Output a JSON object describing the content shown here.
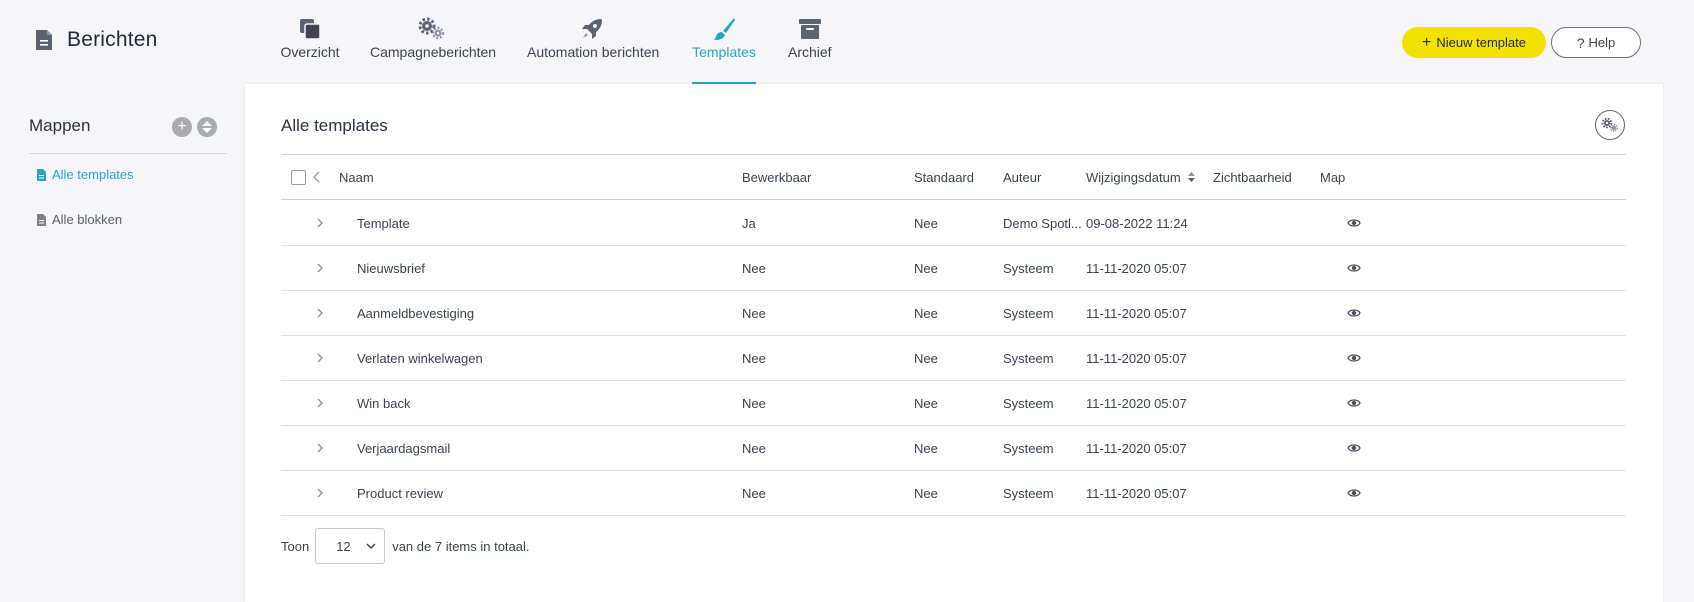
{
  "header": {
    "app_title": "Berichten",
    "nav": [
      {
        "label": "Overzicht",
        "icon": "overview-icon"
      },
      {
        "label": "Campagneberichten",
        "icon": "gears-icon"
      },
      {
        "label": "Automation berichten",
        "icon": "rocket-icon"
      },
      {
        "label": "Templates",
        "icon": "paintbrush-icon",
        "active": true
      },
      {
        "label": "Archief",
        "icon": "archive-box-icon"
      }
    ],
    "new_template_label": "Nieuw template",
    "help_label": "Help"
  },
  "sidebar": {
    "title": "Mappen",
    "items": [
      {
        "label": "Alle templates",
        "active": true
      },
      {
        "label": "Alle blokken",
        "active": false
      }
    ]
  },
  "main": {
    "title": "Alle templates",
    "columns": [
      "Naam",
      "Bewerkbaar",
      "Standaard",
      "Auteur",
      "Wijzigingsdatum",
      "Zichtbaarheid",
      "Map"
    ],
    "rows": [
      {
        "naam": "Template",
        "bewerkbaar": "Ja",
        "standaard": "Nee",
        "auteur": "Demo Spotl...",
        "datum": "09-08-2022 11:24"
      },
      {
        "naam": "Nieuwsbrief",
        "bewerkbaar": "Nee",
        "standaard": "Nee",
        "auteur": "Systeem",
        "datum": "11-11-2020 05:07"
      },
      {
        "naam": "Aanmeldbevestiging",
        "bewerkbaar": "Nee",
        "standaard": "Nee",
        "auteur": "Systeem",
        "datum": "11-11-2020 05:07"
      },
      {
        "naam": "Verlaten winkelwagen",
        "bewerkbaar": "Nee",
        "standaard": "Nee",
        "auteur": "Systeem",
        "datum": "11-11-2020 05:07"
      },
      {
        "naam": "Win back",
        "bewerkbaar": "Nee",
        "standaard": "Nee",
        "auteur": "Systeem",
        "datum": "11-11-2020 05:07"
      },
      {
        "naam": "Verjaardagsmail",
        "bewerkbaar": "Nee",
        "standaard": "Nee",
        "auteur": "Systeem",
        "datum": "11-11-2020 05:07"
      },
      {
        "naam": "Product review",
        "bewerkbaar": "Nee",
        "standaard": "Nee",
        "auteur": "Systeem",
        "datum": "11-11-2020 05:07"
      }
    ],
    "footer": {
      "show_label": "Toon",
      "page_size": "12",
      "total_text": "van de 7 items in totaal."
    }
  },
  "colors": {
    "accent": "#2aa3c8",
    "new_button": "#f2e200",
    "background": "#f6f6f8",
    "panel": "#ffffff"
  }
}
